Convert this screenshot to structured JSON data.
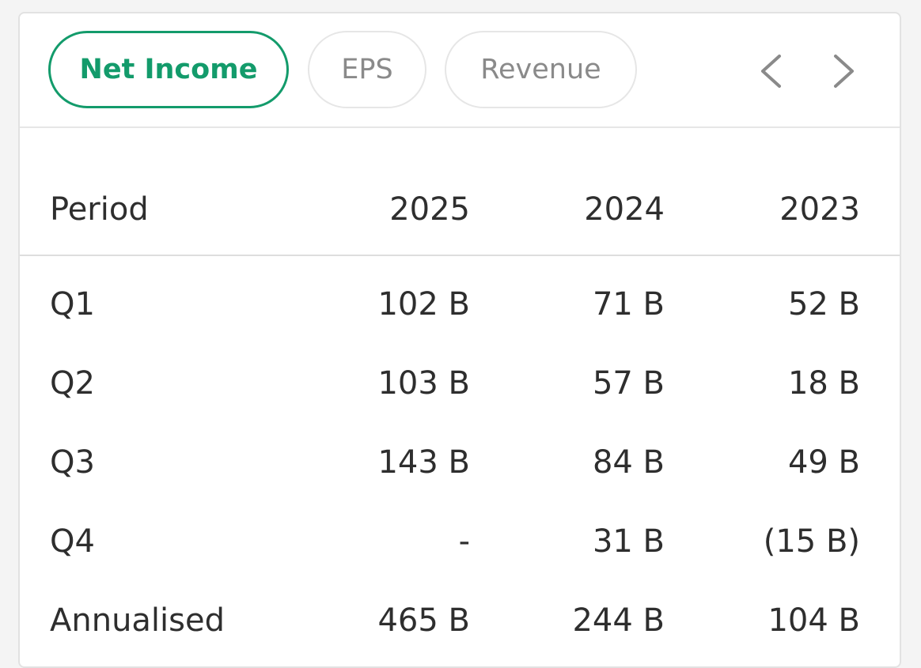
{
  "tabs": [
    {
      "label": "Net Income",
      "active": true
    },
    {
      "label": "EPS",
      "active": false
    },
    {
      "label": "Revenue",
      "active": false
    }
  ],
  "nav": {
    "prev_icon": "chevron-left-icon",
    "next_icon": "chevron-right-icon"
  },
  "colors": {
    "accent": "#139b6b",
    "text": "#2e2e2e",
    "muted": "#8a8a8a",
    "border": "#e2e2e2"
  },
  "table": {
    "headers": [
      "Period",
      "2025",
      "2024",
      "2023"
    ],
    "rows": [
      [
        "Q1",
        "102 B",
        "71 B",
        "52 B"
      ],
      [
        "Q2",
        "103 B",
        "57 B",
        "18 B"
      ],
      [
        "Q3",
        "143 B",
        "84 B",
        "49 B"
      ],
      [
        "Q4",
        "-",
        "31 B",
        "(15 B)"
      ],
      [
        "Annualised",
        "465 B",
        "244 B",
        "104 B"
      ]
    ]
  }
}
